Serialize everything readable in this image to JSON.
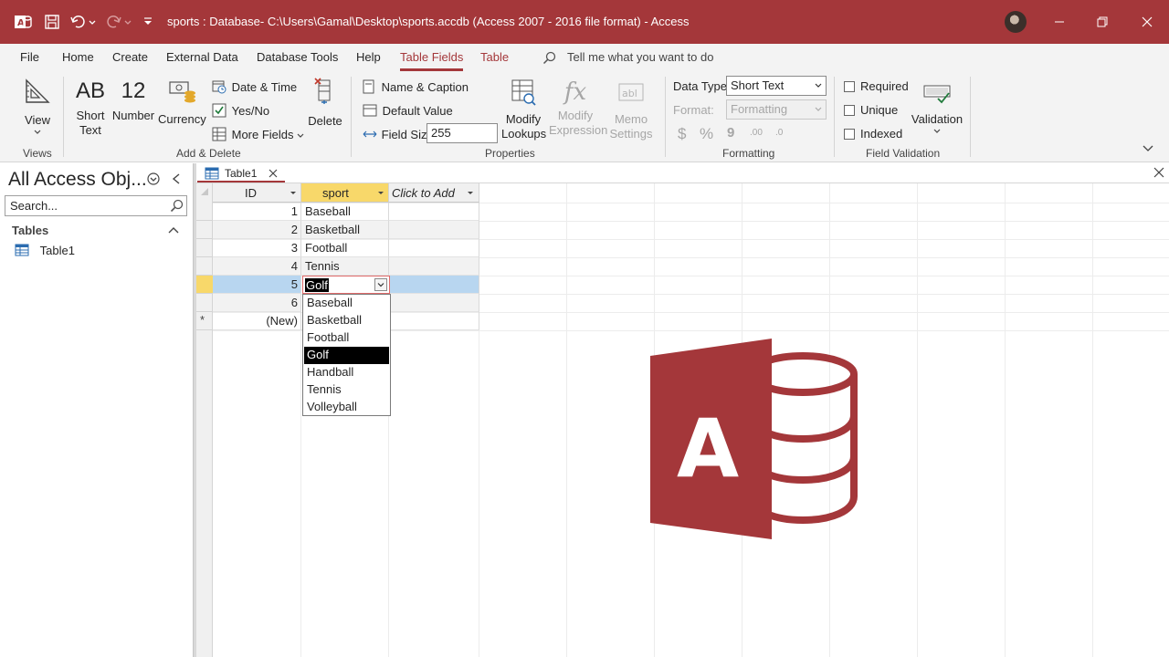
{
  "window": {
    "title": "sports : Database- C:\\Users\\Gamal\\Desktop\\sports.accdb (Access 2007 - 2016 file format)  -  Access"
  },
  "ribbon_tabs": [
    "File",
    "Home",
    "Create",
    "External Data",
    "Database Tools",
    "Help",
    "Table Fields",
    "Table"
  ],
  "tell_me": "Tell me what you want to do",
  "ribbon": {
    "views": {
      "view_label": "View",
      "group": "Views"
    },
    "add_delete": {
      "short_text_icon": "AB",
      "short_text_l1": "Short",
      "short_text_l2": "Text",
      "number_icon": "12",
      "number": "Number",
      "currency": "Currency",
      "date_time": "Date & Time",
      "yes_no": "Yes/No",
      "more_fields": "More Fields",
      "delete": "Delete",
      "group": "Add & Delete"
    },
    "properties": {
      "name_caption": "Name & Caption",
      "default_value": "Default Value",
      "field_size_label": "Field Size",
      "field_size_value": "255",
      "modify_lookups_l1": "Modify",
      "modify_lookups_l2": "Lookups",
      "modify_expr_l1": "Modify",
      "modify_expr_l2": "Expression",
      "memo_l1": "Memo",
      "memo_l2": "Settings",
      "group": "Properties"
    },
    "formatting": {
      "data_type_label": "Data Type:",
      "data_type_value": "Short Text",
      "format_label": "Format:",
      "format_value": "Formatting",
      "currency_sym": "$",
      "percent_sym": "%",
      "comma_sym": "9",
      "inc_dec": ".00",
      "dec_dec": ".0",
      "group": "Formatting"
    },
    "validation": {
      "required": "Required",
      "unique": "Unique",
      "indexed": "Indexed",
      "validation": "Validation",
      "group": "Field Validation"
    }
  },
  "nav": {
    "title": "All Access Obj...",
    "search_placeholder": "Search...",
    "section": "Tables",
    "items": [
      "Table1"
    ]
  },
  "doc_tab": "Table1",
  "table": {
    "headers": [
      "ID",
      "sport",
      "Click to Add"
    ],
    "rows": [
      {
        "id": "1",
        "sport": "Baseball"
      },
      {
        "id": "2",
        "sport": "Basketball"
      },
      {
        "id": "3",
        "sport": "Football"
      },
      {
        "id": "4",
        "sport": "Tennis"
      },
      {
        "id": "5",
        "sport": "Golf"
      },
      {
        "id": "6",
        "sport": ""
      }
    ],
    "new_row": "(New)"
  },
  "dropdown": {
    "current": "Golf",
    "options": [
      "Baseball",
      "Basketball",
      "Football",
      "Golf",
      "Handball",
      "Tennis",
      "Volleyball"
    ],
    "selected": "Golf"
  },
  "colors": {
    "brand": "#a4373a",
    "header_selected": "#f8d86a",
    "row_selected": "#b8d6f0"
  }
}
